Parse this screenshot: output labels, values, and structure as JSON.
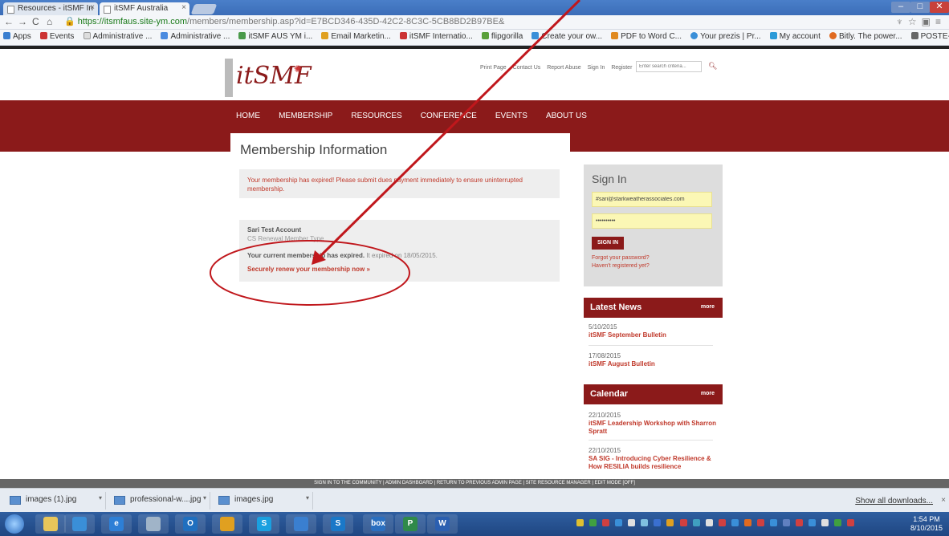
{
  "browser": {
    "tabs": [
      {
        "title": "Resources - itSMF In",
        "close": "×"
      },
      {
        "title": "itSMF Australia",
        "close": "×"
      }
    ],
    "url": {
      "scheme": "https://",
      "host": "itsmfaus.site-ym.com",
      "path": "/members/membership.asp?id=E7BCD346-435D-42C2-8C3C-5CB8BD2B97BE&"
    },
    "bookmarks": [
      "Apps",
      "Events",
      "Administrative ...",
      "Administrative ...",
      "itSMF AUS YM i...",
      "Email Marketin...",
      "itSMF Internatio...",
      "flipgorilla",
      "Create your ow...",
      "PDF to Word C...",
      "Your prezis | Pr...",
      "My account",
      "Bitly. The power...",
      "POSTE-HASTE -..."
    ]
  },
  "site": {
    "logo_text": "itSMF",
    "top_links": [
      "Print Page",
      "Contact Us",
      "Report Abuse",
      "Sign In",
      "Register"
    ],
    "search_placeholder": "Enter search criteria...",
    "nav": [
      "HOME",
      "MEMBERSHIP",
      "RESOURCES",
      "CONFERENCE",
      "EVENTS",
      "ABOUT US"
    ]
  },
  "membership": {
    "title": "Membership Information",
    "alert": "Your membership has expired! Please submit dues payment immediately to ensure uninterrupted membership.",
    "account_name": "Sari Test Account",
    "account_sub": "CS Renewal Member Type",
    "status_bold": "Your current membership has expired.",
    "status_rest": "It expired on 18/05/2015.",
    "renew_link": "Securely renew your membership now »"
  },
  "signin": {
    "title": "Sign In",
    "username": "#sari@starkweatherassociates.com",
    "password": "••••••••••",
    "button": "SIGN IN",
    "forgot": "Forgot your password?",
    "register": "Haven't registered yet?"
  },
  "latest_news": {
    "title": "Latest News",
    "more": "more",
    "items": [
      {
        "date": "5/10/2015",
        "title": "itSMF September Bulletin"
      },
      {
        "date": "17/08/2015",
        "title": "itSMF August Bulletin"
      }
    ]
  },
  "calendar": {
    "title": "Calendar",
    "more": "more",
    "items": [
      {
        "date": "22/10/2015",
        "title": "itSMF Leadership Workshop with Sharron Spratt"
      },
      {
        "date": "22/10/2015",
        "title": "SA SIG - Introducing Cyber Resilience & How RESILIA builds resilience"
      }
    ]
  },
  "admin_bar": "SIGN IN TO THE COMMUNITY | ADMIN DASHBOARD | RETURN TO PREVIOUS ADMIN PAGE | SITE RESOURCE MANAGER | EDIT MODE [OFF]",
  "downloads": {
    "files": [
      "images (1).jpg",
      "professional-w....jpg",
      "images.jpg"
    ],
    "show_all": "Show all downloads...",
    "close": "×"
  },
  "taskbar": {
    "apps": [
      {
        "icon": "folder-icon",
        "glyph": "",
        "color": "#e8c65a"
      },
      {
        "icon": "media-player-icon",
        "glyph": "",
        "color": "#3a8fd8"
      },
      {
        "icon": "ie-icon",
        "glyph": "e",
        "color": "#2d7fd6"
      },
      {
        "icon": "tools-icon",
        "glyph": "",
        "color": "#a0b4c8"
      },
      {
        "icon": "outlook-icon",
        "glyph": "O",
        "color": "#1f6fbf"
      },
      {
        "icon": "chrome-icon",
        "glyph": "",
        "color": "#e0a020"
      },
      {
        "icon": "skype-icon",
        "glyph": "S",
        "color": "#1aa0e0"
      },
      {
        "icon": "onedrive-icon",
        "glyph": "",
        "color": "#3a7fd0"
      },
      {
        "icon": "skype-business-icon",
        "glyph": "S",
        "color": "#1a78c8"
      },
      {
        "icon": "box-icon",
        "glyph": "box",
        "color": "#2a6fc0"
      },
      {
        "icon": "project-icon",
        "glyph": "P",
        "color": "#2f8a4a"
      },
      {
        "icon": "word-icon",
        "glyph": "W",
        "color": "#2b5fb0"
      }
    ],
    "time": "1:54 PM",
    "date": "8/10/2015"
  },
  "colors": {
    "brand": "#8b1a1a",
    "link": "#c0392b",
    "annotation": "#c0171c"
  }
}
